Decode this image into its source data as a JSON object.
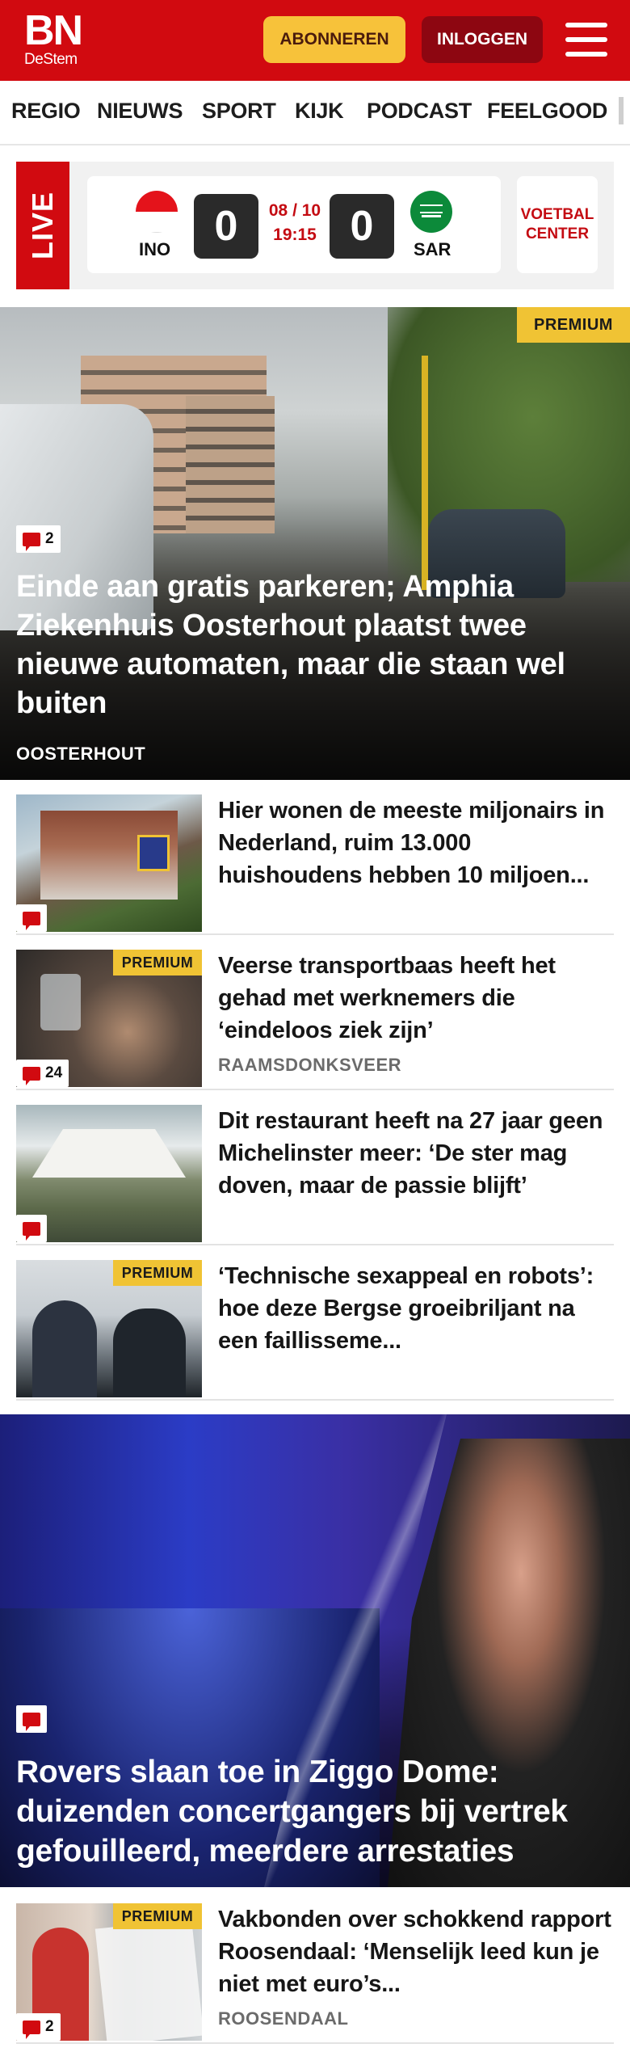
{
  "header": {
    "logo_main": "BN",
    "logo_sub": "DeStem",
    "subscribe_label": "ABONNEREN",
    "login_label": "INLOGGEN"
  },
  "nav": {
    "items": [
      "REGIO",
      "NIEUWS",
      "SPORT",
      "KIJK",
      "PODCAST",
      "FEELGOOD"
    ]
  },
  "live": {
    "label": "LIVE",
    "home_team": "INO",
    "away_team": "SAR",
    "home_score": "0",
    "away_score": "0",
    "date": "08 / 10",
    "time": "19:15",
    "center_label": "VOETBAL CENTER"
  },
  "hero1": {
    "badge": "PREMIUM",
    "comments": "2",
    "title": "Einde aan gratis parkeren; Amphia Ziekenhuis Oosterhout plaatst twee nieuwe automaten, maar die staan wel buiten",
    "location": "OOSTERHOUT"
  },
  "articles": [
    {
      "title": "Hier wonen de meeste miljonairs in Nederland, ruim 13.000 huishoudens hebben 10 miljoen...",
      "location": "",
      "badge": "",
      "comments": ""
    },
    {
      "title": "Veerse transportbaas heeft het gehad met werknemers die ‘eindeloos ziek zijn’",
      "location": "RAAMSDONKSVEER",
      "badge": "PREMIUM",
      "comments": "24"
    },
    {
      "title": "Dit restaurant heeft na 27 jaar geen Michelinster meer: ‘De ster mag doven, maar de passie blijft’",
      "location": "",
      "badge": "",
      "comments": ""
    },
    {
      "title": "‘Technische sexappeal en robots’: hoe deze Bergse groeibriljant na een faillisseme...",
      "location": "",
      "badge": "PREMIUM",
      "comments": ""
    }
  ],
  "hero2": {
    "title": "Rovers slaan toe in Ziggo Dome: duizenden concertgangers bij vertrek gefouilleerd, meerdere arrestaties"
  },
  "articles2": [
    {
      "title": "Vakbonden over schokkend rapport Roosendaal: ‘Menselijk leed kun je niet met euro’s...",
      "location": "ROOSENDAAL",
      "badge": "PREMIUM",
      "comments": "2"
    }
  ],
  "colors": {
    "brand_red": "#d10a10",
    "premium_yellow": "#f0c334",
    "login_dark_red": "#8d0611"
  }
}
